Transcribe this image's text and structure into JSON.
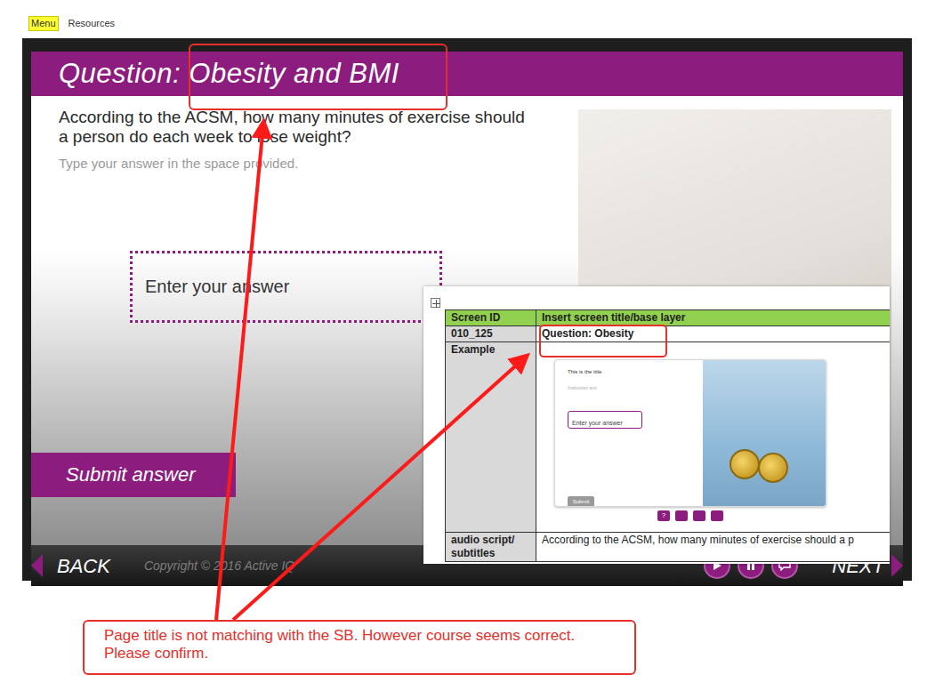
{
  "top_menu": [
    {
      "label": "Menu",
      "selected": true
    },
    {
      "label": "Resources",
      "selected": false
    }
  ],
  "slide": {
    "title": "Question: Obesity and BMI",
    "question": "According to the ACSM, how many minutes of exercise should a person do each week to lose weight?",
    "instruction": "Type your answer in the space provided.",
    "answer_placeholder": "Enter your answer",
    "submit_button": "Submit answer"
  },
  "player": {
    "back": "BACK",
    "copyright": "Copyright © 2016 Active IQ",
    "next": "NEXT"
  },
  "storyboard": {
    "columns": [
      "Screen ID",
      "Insert screen title/base layer"
    ],
    "screen_id": "010_125",
    "screen_title": "Question: Obesity",
    "example_label": "Example",
    "example": {
      "title": "This is the title",
      "instruction": "Instruction text",
      "answer_placeholder": "Enter your answer",
      "submit_button": "Submit",
      "help_key": "?"
    },
    "audio_label": "audio script/ subtitles",
    "audio_text": "According to the ACSM, how many minutes of exercise should a p"
  },
  "annotation": {
    "comment": "Page title is not matching with the SB. However course seems correct. Please confirm."
  }
}
